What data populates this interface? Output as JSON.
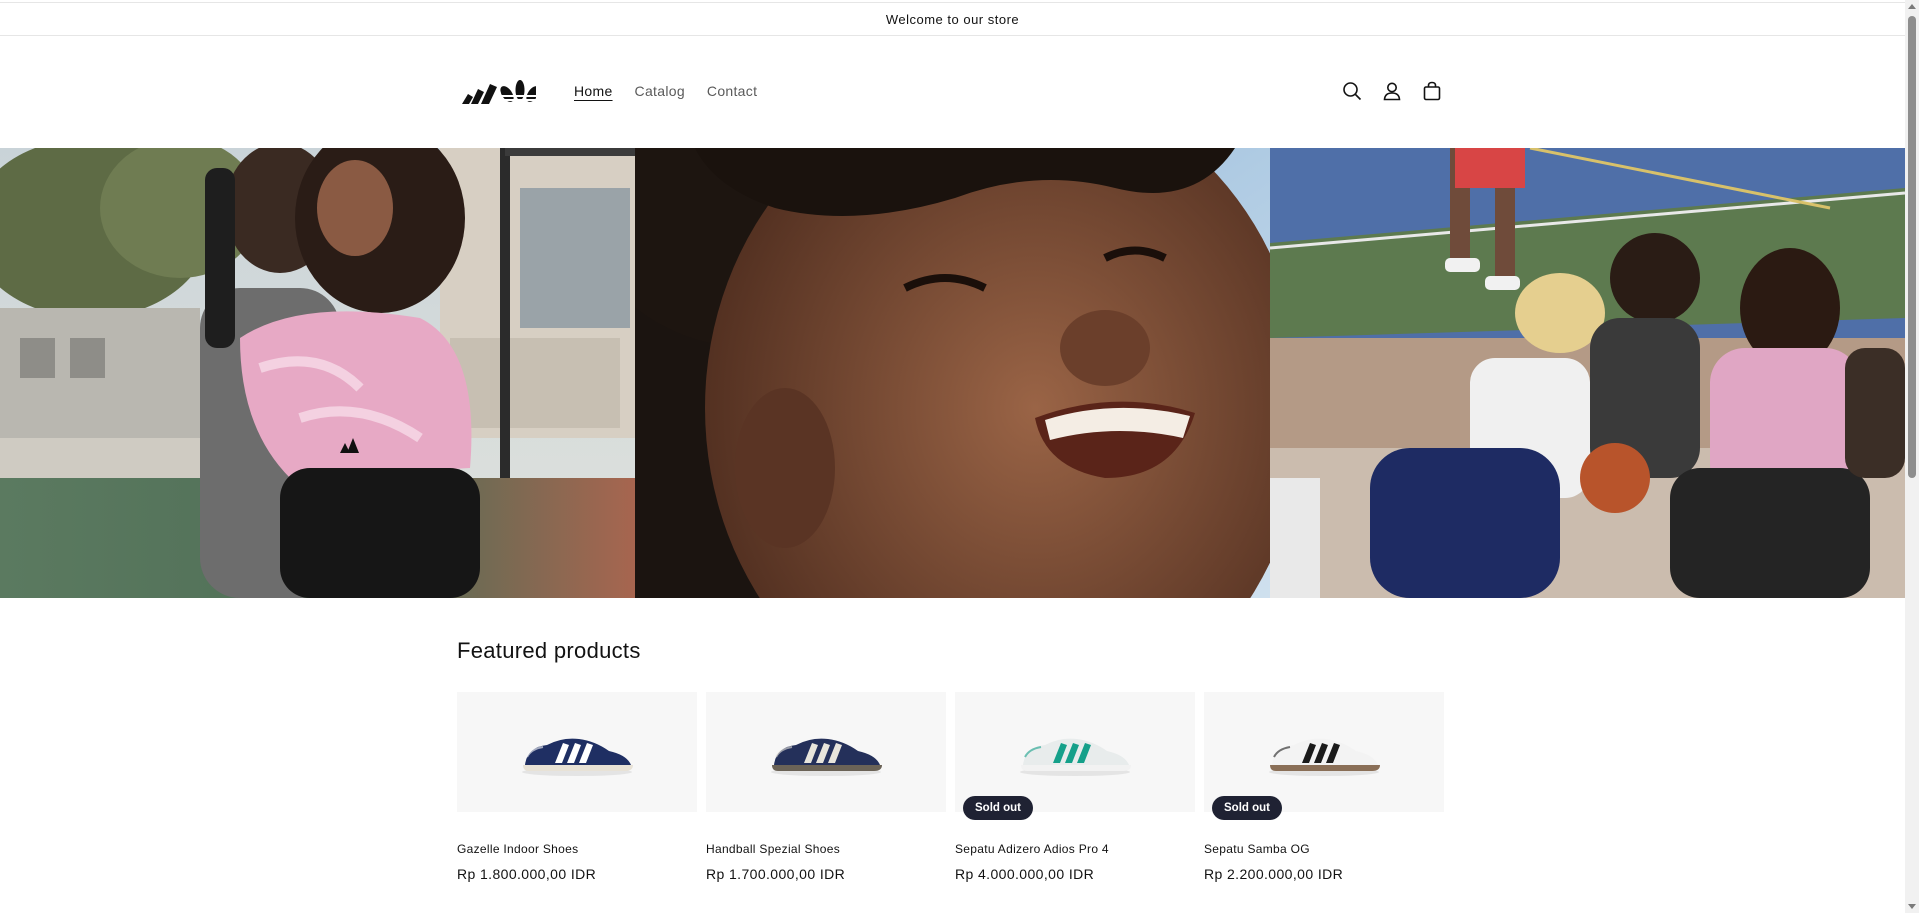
{
  "announcement": {
    "text": "Welcome to our store"
  },
  "header": {
    "logo": "adidas-logo",
    "nav": [
      {
        "label": "Home",
        "active": true
      },
      {
        "label": "Catalog",
        "active": false
      },
      {
        "label": "Contact",
        "active": false
      }
    ],
    "icons": [
      "search-icon",
      "account-icon",
      "cart-icon"
    ]
  },
  "hero": {
    "panels": [
      "friends-dancing-photo",
      "smiling-face-photo",
      "basketball-court-photo"
    ]
  },
  "featured": {
    "title": "Featured products",
    "products": [
      {
        "name": "Gazelle Indoor Shoes",
        "price": "Rp 1.800.000,00 IDR",
        "sold_out": false,
        "badge": "",
        "shoe_color": "#1f2f63",
        "stripe_color": "#ffffff",
        "sole_color": "#e8e2d6"
      },
      {
        "name": "Handball Spezial Shoes",
        "price": "Rp 1.700.000,00 IDR",
        "sold_out": false,
        "badge": "",
        "shoe_color": "#24305a",
        "stripe_color": "#e8e5dc",
        "sole_color": "#6b6357"
      },
      {
        "name": "Sepatu Adizero Adios Pro 4",
        "price": "Rp 4.000.000,00 IDR",
        "sold_out": true,
        "badge": "Sold out",
        "shoe_color": "#e8ecec",
        "stripe_color": "#15a08a",
        "sole_color": "#f2f2f2"
      },
      {
        "name": "Sepatu Samba OG",
        "price": "Rp 2.200.000,00 IDR",
        "sold_out": true,
        "badge": "Sold out",
        "shoe_color": "#f3f3f3",
        "stripe_color": "#1a1a1a",
        "sole_color": "#8a6f57"
      }
    ]
  },
  "colors": {
    "badge_bg": "#1f2233",
    "text": "#121212"
  }
}
